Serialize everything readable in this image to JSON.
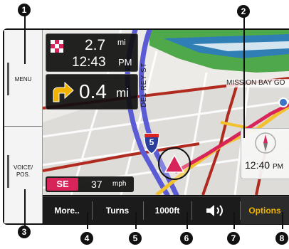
{
  "side_panel": {
    "menu_label": "MENU",
    "voice_label_line1": "VOICE/",
    "voice_label_line2": "POS."
  },
  "info_panel": {
    "distance": "2.7",
    "distance_unit": "mi",
    "eta_time": "12:43",
    "eta_ampm": "PM"
  },
  "next_turn": {
    "distance": "0.4",
    "unit": "mi"
  },
  "map": {
    "street_vertical": "DEL REY ST",
    "street_horizontal": "MISSION BAY GO",
    "interstate_number": "5"
  },
  "speed_panel": {
    "heading": "SE",
    "speed": "37",
    "unit": "mph"
  },
  "clock": {
    "time": "12:40",
    "ampm": "PM"
  },
  "toolbar": {
    "more_label": "More..",
    "turns_label": "Turns",
    "zoom_label": "1000ft",
    "options_label": "Options"
  },
  "callouts": [
    "1",
    "2",
    "3",
    "4",
    "5",
    "6",
    "7",
    "8"
  ],
  "colors": {
    "route": "#d7255a",
    "accent_options": "#f0b400",
    "highway_blue": "#5b5bd6",
    "major_road": "#f2c12e",
    "minor_road": "#b02a1f",
    "water": "#2f7fb5",
    "park": "#4fa84a"
  }
}
